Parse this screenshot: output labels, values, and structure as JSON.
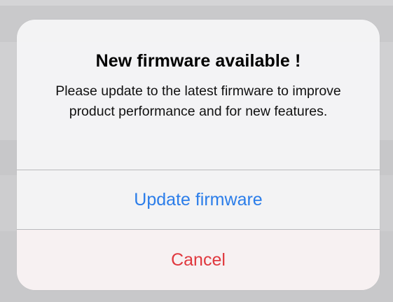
{
  "alert": {
    "title": "New firmware available !",
    "message": "Please update to the latest firmware to improve product performance and for new features.",
    "actions": {
      "update_label": "Update firmware",
      "cancel_label": "Cancel"
    }
  },
  "colors": {
    "primary_action": "#2b7de9",
    "destructive_action": "#e0383e",
    "alert_background": "#f5f5f6",
    "divider": "#b9b9bc"
  }
}
